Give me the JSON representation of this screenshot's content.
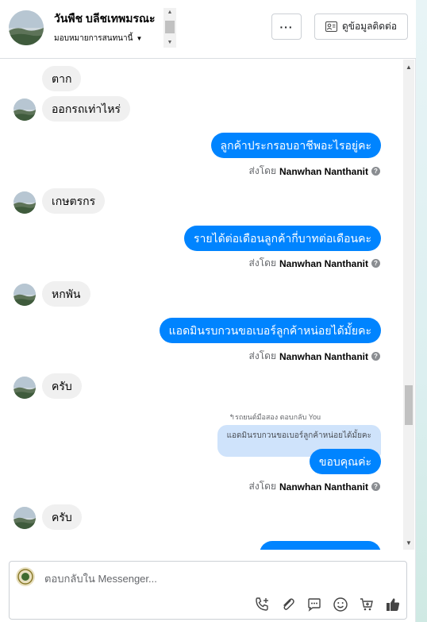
{
  "header": {
    "contact_name": "วันพืช บลีชเทพมรณะ",
    "assign_label": "มอบหมายการสนทนานี้",
    "more_label": "···",
    "contact_info_label": "ดูข้อมูลติดต่อ"
  },
  "messages": {
    "m1": "ตาก",
    "m2": "ออกรถเท่าไหร่",
    "m3": "ลูกค้าประกรอบอาชีพอะไรอยู่คะ",
    "m4": "เกษตรกร",
    "m5": "รายได้ต่อเดือนลูกค้ากี่บาทต่อเดือนคะ",
    "m6": "หกพัน",
    "m7": "แอดมินรบกวนขอเบอร์ลูกค้าหน่อยได้มั้ยคะ",
    "m8": "ครับ",
    "reply_note": "↰รถยนต์มือสอง ตอบกลับ You",
    "quoted_text": "แอดมินรบกวนขอเบอร์ลูกค้าหน่อยได้มั้ยคะ",
    "m9": "ขอบคุณค่ะ",
    "m10": "ครับ"
  },
  "sent_by": {
    "prefix": "ส่งโดย",
    "agent": "Nanwhan Nanthanit",
    "info_glyph": "?"
  },
  "composer": {
    "placeholder": "ตอบกลับใน Messenger..."
  },
  "colors": {
    "outgoing_bubble": "#0084ff",
    "incoming_bubble": "#f0f0f0",
    "quoted_bubble": "#cfe3fb"
  },
  "icons": [
    "call-icon",
    "attach-icon",
    "saved-replies-icon",
    "emoji-icon",
    "cart-icon",
    "like-icon",
    "info-icon",
    "contact-card-icon",
    "caret-down-icon"
  ]
}
